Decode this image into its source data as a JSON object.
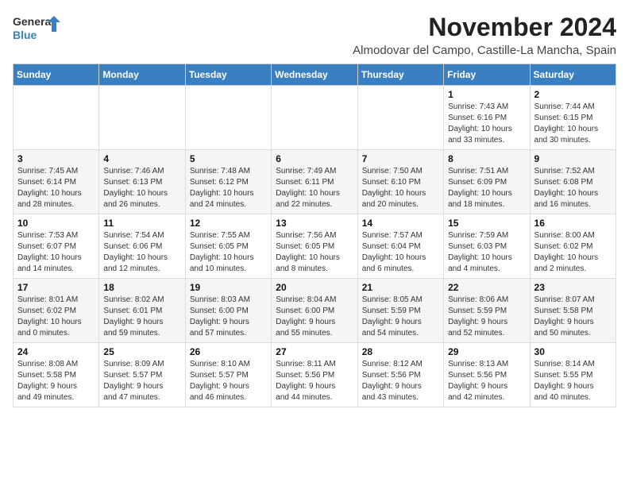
{
  "header": {
    "logo_line1": "General",
    "logo_line2": "Blue",
    "month_title": "November 2024",
    "subtitle": "Almodovar del Campo, Castille-La Mancha, Spain"
  },
  "weekdays": [
    "Sunday",
    "Monday",
    "Tuesday",
    "Wednesday",
    "Thursday",
    "Friday",
    "Saturday"
  ],
  "weeks": [
    [
      {
        "day": "",
        "info": ""
      },
      {
        "day": "",
        "info": ""
      },
      {
        "day": "",
        "info": ""
      },
      {
        "day": "",
        "info": ""
      },
      {
        "day": "",
        "info": ""
      },
      {
        "day": "1",
        "info": "Sunrise: 7:43 AM\nSunset: 6:16 PM\nDaylight: 10 hours\nand 33 minutes."
      },
      {
        "day": "2",
        "info": "Sunrise: 7:44 AM\nSunset: 6:15 PM\nDaylight: 10 hours\nand 30 minutes."
      }
    ],
    [
      {
        "day": "3",
        "info": "Sunrise: 7:45 AM\nSunset: 6:14 PM\nDaylight: 10 hours\nand 28 minutes."
      },
      {
        "day": "4",
        "info": "Sunrise: 7:46 AM\nSunset: 6:13 PM\nDaylight: 10 hours\nand 26 minutes."
      },
      {
        "day": "5",
        "info": "Sunrise: 7:48 AM\nSunset: 6:12 PM\nDaylight: 10 hours\nand 24 minutes."
      },
      {
        "day": "6",
        "info": "Sunrise: 7:49 AM\nSunset: 6:11 PM\nDaylight: 10 hours\nand 22 minutes."
      },
      {
        "day": "7",
        "info": "Sunrise: 7:50 AM\nSunset: 6:10 PM\nDaylight: 10 hours\nand 20 minutes."
      },
      {
        "day": "8",
        "info": "Sunrise: 7:51 AM\nSunset: 6:09 PM\nDaylight: 10 hours\nand 18 minutes."
      },
      {
        "day": "9",
        "info": "Sunrise: 7:52 AM\nSunset: 6:08 PM\nDaylight: 10 hours\nand 16 minutes."
      }
    ],
    [
      {
        "day": "10",
        "info": "Sunrise: 7:53 AM\nSunset: 6:07 PM\nDaylight: 10 hours\nand 14 minutes."
      },
      {
        "day": "11",
        "info": "Sunrise: 7:54 AM\nSunset: 6:06 PM\nDaylight: 10 hours\nand 12 minutes."
      },
      {
        "day": "12",
        "info": "Sunrise: 7:55 AM\nSunset: 6:05 PM\nDaylight: 10 hours\nand 10 minutes."
      },
      {
        "day": "13",
        "info": "Sunrise: 7:56 AM\nSunset: 6:05 PM\nDaylight: 10 hours\nand 8 minutes."
      },
      {
        "day": "14",
        "info": "Sunrise: 7:57 AM\nSunset: 6:04 PM\nDaylight: 10 hours\nand 6 minutes."
      },
      {
        "day": "15",
        "info": "Sunrise: 7:59 AM\nSunset: 6:03 PM\nDaylight: 10 hours\nand 4 minutes."
      },
      {
        "day": "16",
        "info": "Sunrise: 8:00 AM\nSunset: 6:02 PM\nDaylight: 10 hours\nand 2 minutes."
      }
    ],
    [
      {
        "day": "17",
        "info": "Sunrise: 8:01 AM\nSunset: 6:02 PM\nDaylight: 10 hours\nand 0 minutes."
      },
      {
        "day": "18",
        "info": "Sunrise: 8:02 AM\nSunset: 6:01 PM\nDaylight: 9 hours\nand 59 minutes."
      },
      {
        "day": "19",
        "info": "Sunrise: 8:03 AM\nSunset: 6:00 PM\nDaylight: 9 hours\nand 57 minutes."
      },
      {
        "day": "20",
        "info": "Sunrise: 8:04 AM\nSunset: 6:00 PM\nDaylight: 9 hours\nand 55 minutes."
      },
      {
        "day": "21",
        "info": "Sunrise: 8:05 AM\nSunset: 5:59 PM\nDaylight: 9 hours\nand 54 minutes."
      },
      {
        "day": "22",
        "info": "Sunrise: 8:06 AM\nSunset: 5:59 PM\nDaylight: 9 hours\nand 52 minutes."
      },
      {
        "day": "23",
        "info": "Sunrise: 8:07 AM\nSunset: 5:58 PM\nDaylight: 9 hours\nand 50 minutes."
      }
    ],
    [
      {
        "day": "24",
        "info": "Sunrise: 8:08 AM\nSunset: 5:58 PM\nDaylight: 9 hours\nand 49 minutes."
      },
      {
        "day": "25",
        "info": "Sunrise: 8:09 AM\nSunset: 5:57 PM\nDaylight: 9 hours\nand 47 minutes."
      },
      {
        "day": "26",
        "info": "Sunrise: 8:10 AM\nSunset: 5:57 PM\nDaylight: 9 hours\nand 46 minutes."
      },
      {
        "day": "27",
        "info": "Sunrise: 8:11 AM\nSunset: 5:56 PM\nDaylight: 9 hours\nand 44 minutes."
      },
      {
        "day": "28",
        "info": "Sunrise: 8:12 AM\nSunset: 5:56 PM\nDaylight: 9 hours\nand 43 minutes."
      },
      {
        "day": "29",
        "info": "Sunrise: 8:13 AM\nSunset: 5:56 PM\nDaylight: 9 hours\nand 42 minutes."
      },
      {
        "day": "30",
        "info": "Sunrise: 8:14 AM\nSunset: 5:55 PM\nDaylight: 9 hours\nand 40 minutes."
      }
    ]
  ]
}
